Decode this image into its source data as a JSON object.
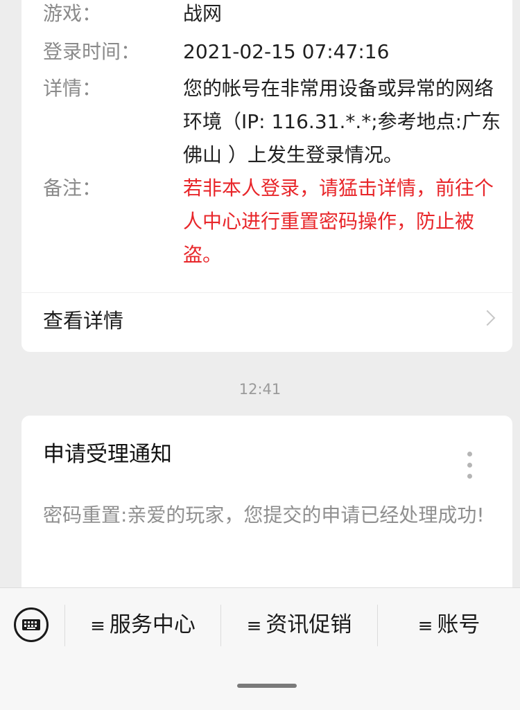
{
  "login_card": {
    "rows": [
      {
        "label": "游戏：",
        "value": "战网"
      },
      {
        "label": "登录时间：",
        "value": "2021-02-15 07:47:16"
      },
      {
        "label": "详情：",
        "value": "您的帐号在非常用设备或异常的网络环境（IP: 116.31.*.*;参考地点:广东佛山 ）上发生登录情况。"
      },
      {
        "label": "备注：",
        "value": "若非本人登录，请猛击详情，前往个人中心进行重置密码操作，防止被盗。"
      }
    ],
    "view_details_label": "查看详情"
  },
  "timestamp": "12:41",
  "notice_card": {
    "title": "申请受理通知",
    "body": "密码重置:亲爱的玩家，您提交的申请已经处理成功!"
  },
  "bottom_menu": {
    "keyboard_icon": "keyboard-icon",
    "menu_icon": "≡",
    "items": [
      {
        "label": "服务中心"
      },
      {
        "label": "资讯促销"
      },
      {
        "label": "账号"
      }
    ]
  },
  "colors": {
    "background": "#ededed",
    "card": "#ffffff",
    "label_gray": "#8a8a8a",
    "warning_red": "#e8262a"
  }
}
